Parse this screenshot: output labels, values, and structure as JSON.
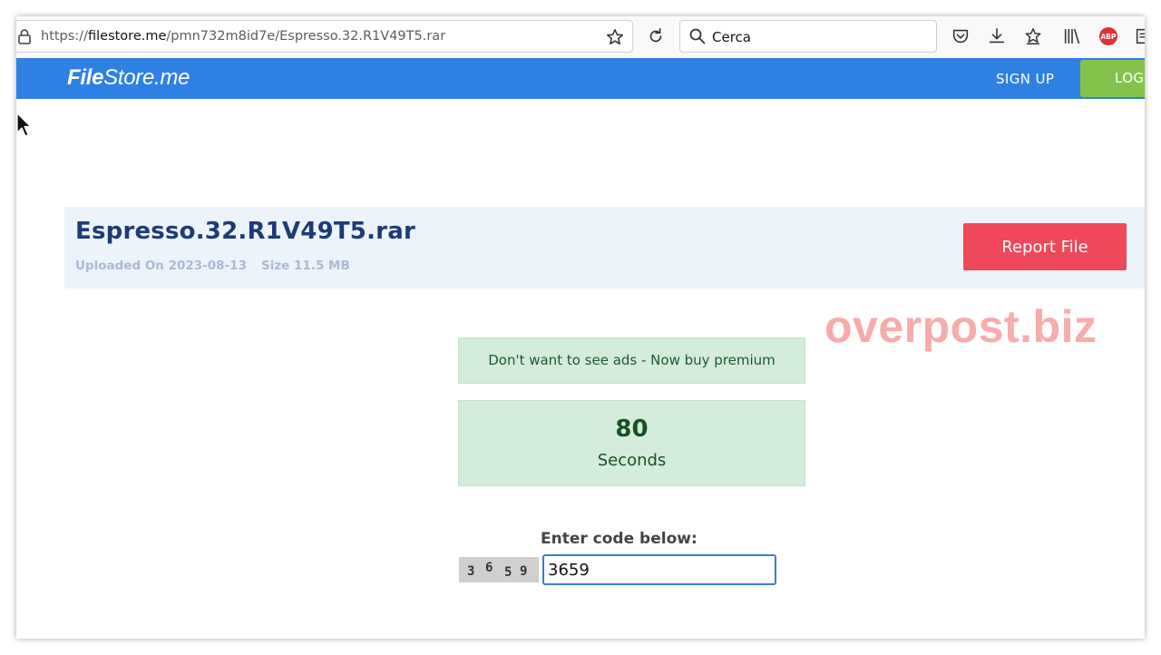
{
  "browser": {
    "url_prefix": "https://",
    "url_host": "filestore.me",
    "url_path": "/pmn732m8id7e/Espresso.32.R1V49T5.rar",
    "search_placeholder": "Cerca",
    "abp_label": "ABP"
  },
  "header": {
    "logo_bold": "File",
    "logo_rest": "Store.me",
    "signup_label": "SIGN UP",
    "login_label": "LOGIN"
  },
  "file": {
    "name": "Espresso.32.R1V49T5.rar",
    "uploaded": "Uploaded On 2023-08-13",
    "size": "Size 11.5 MB",
    "report_label": "Report File"
  },
  "watermark": "overpost.biz",
  "premium_text": "Don't want to see ads - Now buy premium",
  "timer": {
    "value": "80",
    "unit": "Seconds"
  },
  "captcha": {
    "label": "Enter code below:",
    "digits": [
      "3",
      "6",
      "5",
      "9"
    ],
    "input_value": "3659"
  },
  "colors": {
    "header_bg": "#2f80e3",
    "login_bg": "#84c24c",
    "report_bg": "#ef4859",
    "alert_bg": "#d4ecdc",
    "filename": "#1d3b78"
  }
}
